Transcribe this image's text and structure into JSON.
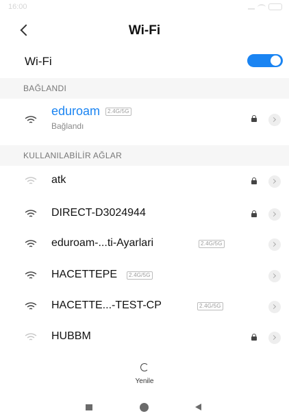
{
  "status_bar": {
    "time": "16:00"
  },
  "header": {
    "title": "Wi-Fi",
    "back_icon": "chevron-left-icon"
  },
  "wifi_toggle": {
    "label": "Wi-Fi",
    "state": "on",
    "accent_color": "#1a84f2"
  },
  "connected_section": {
    "label": "BAĞLANDI",
    "network": {
      "name": "eduroam",
      "band": "2.4G/5G",
      "status": "Bağlandı",
      "secured": true
    }
  },
  "available_section": {
    "label": "KULLANILABİLİR AĞLAR",
    "networks": [
      {
        "name": "atk",
        "band": "",
        "secured": true,
        "signal": "weak"
      },
      {
        "name": "DIRECT-D3024944",
        "band": "",
        "secured": true,
        "signal": "strong"
      },
      {
        "name": "eduroam-...ti-Ayarlari",
        "band": "2.4G/5G",
        "secured": false,
        "signal": "strong"
      },
      {
        "name": "HACETTEPE",
        "band": "2.4G/5G",
        "secured": false,
        "signal": "strong"
      },
      {
        "name": "HACETTE...-TEST-CP",
        "band": "2.4G/5G",
        "secured": false,
        "signal": "strong"
      },
      {
        "name": "HUBBM",
        "band": "",
        "secured": true,
        "signal": "weak"
      }
    ]
  },
  "refresh": {
    "label": "Yenile",
    "icon": "refresh-icon"
  },
  "system_nav": {
    "icons": [
      "recents-icon",
      "home-icon",
      "back-icon"
    ]
  }
}
